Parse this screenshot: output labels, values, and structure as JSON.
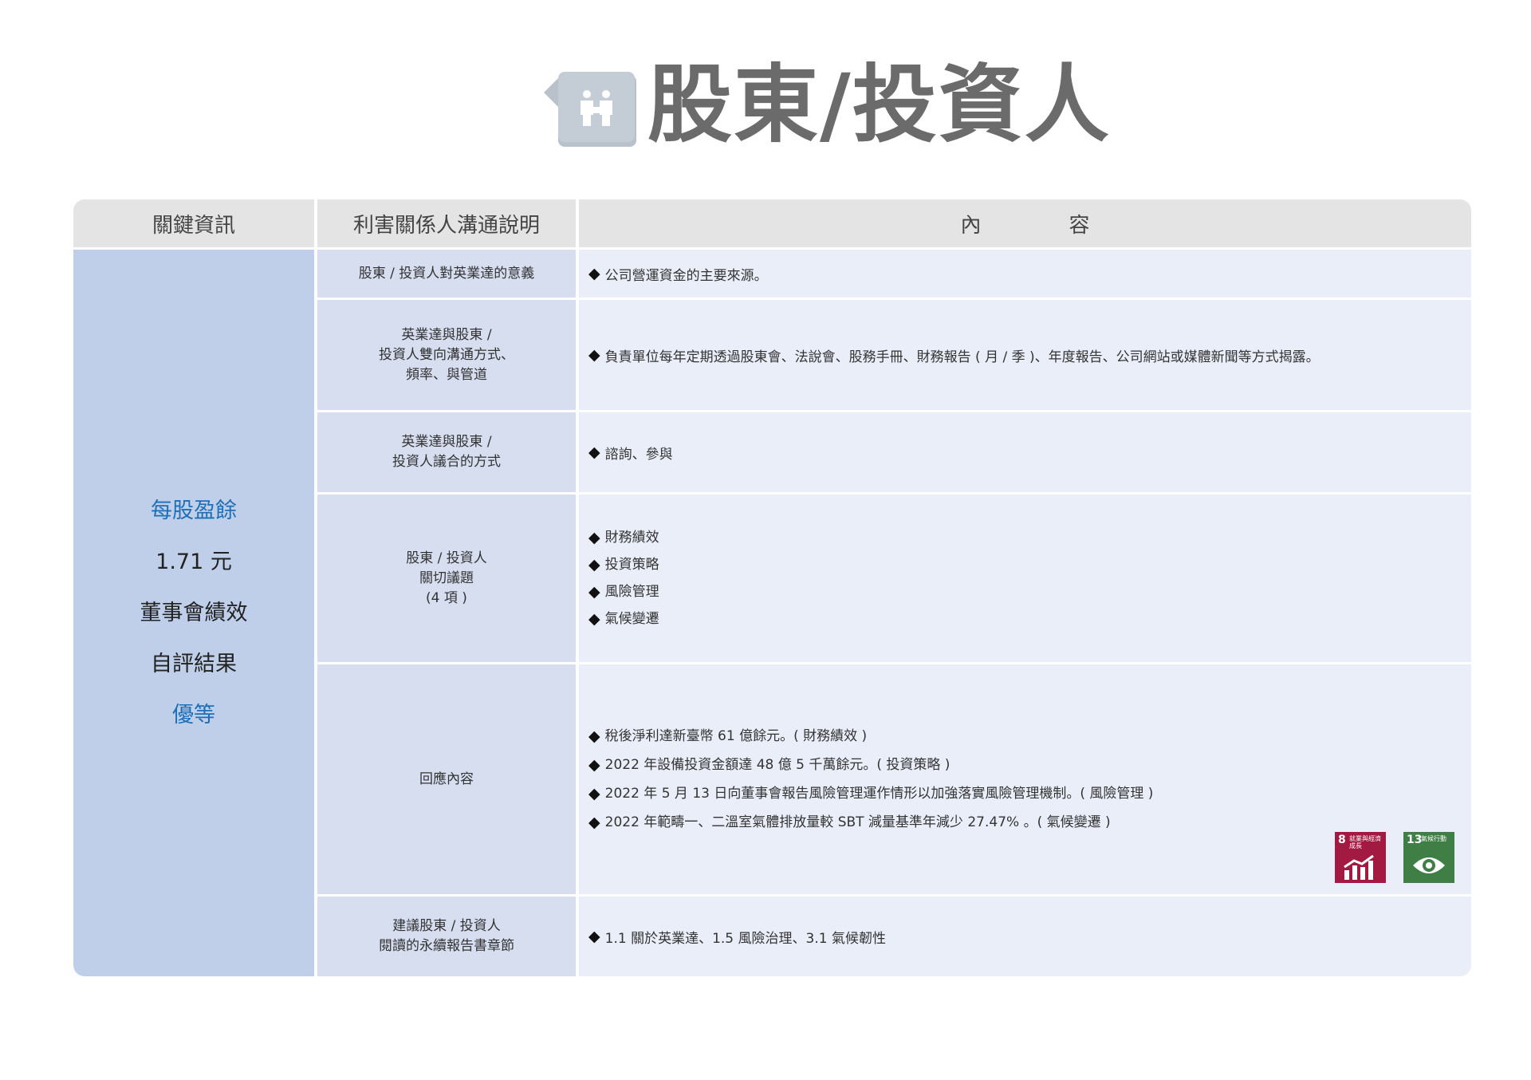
{
  "title": "股東/投資人",
  "icon": "people-icon",
  "table": {
    "headers": [
      "關鍵資訊",
      "利害關係人溝通說明"
    ],
    "header_content": [
      "內",
      "容"
    ],
    "key_info": [
      "每股盈餘",
      "1.71 元",
      "董事會績效",
      "自評結果",
      "優等"
    ],
    "rows": [
      {
        "label": [
          "股東 / 投資人對英業達的意義"
        ],
        "content": [
          "公司營運資金的主要來源。"
        ]
      },
      {
        "label": [
          "英業達與股東 /",
          "投資人雙向溝通方式、",
          "頻率、與管道"
        ],
        "content": [
          "負責單位每年定期透過股東會、法說會、股務手冊、財務報告 ( 月 / 季 )、年度報告、公司網站或媒體新聞等方式揭露。"
        ]
      },
      {
        "label": [
          "英業達與股東 /",
          "投資人議合的方式"
        ],
        "content": [
          "諮詢、參與"
        ]
      },
      {
        "label": [
          "股東 / 投資人",
          "關切議題",
          "(4 項 )"
        ],
        "content": [
          "財務績效",
          "投資策略",
          "風險管理",
          "氣候變遷"
        ]
      },
      {
        "label": [
          "回應內容"
        ],
        "content": [
          "稅後淨利達新臺幣 61 億餘元。( 財務績效 )",
          "2022 年設備投資金額達 48 億 5 千萬餘元。( 投資策略 )",
          "2022 年 5 月 13 日向董事會報告風險管理運作情形以加強落實風險管理機制。( 風險管理 )",
          "2022 年範疇一、二溫室氣體排放量較 SBT 減量基準年減少 27.47% 。( 氣候變遷 )"
        ]
      },
      {
        "label": [
          "建議股東 / 投資人",
          "閱讀的永續報告書章節"
        ],
        "content": [
          "1.1 關於英業達、1.5 風險治理、3.1 氣候韌性"
        ]
      }
    ]
  },
  "sdg_badges": [
    {
      "number": "8",
      "caption": "就業與經濟成長",
      "icon": "growth-chart-icon",
      "color": "#a21942"
    },
    {
      "number": "13",
      "caption": "氣候行動",
      "icon": "eye-earth-icon",
      "color": "#3f7e44"
    }
  ],
  "bullet_symbol": "◆"
}
